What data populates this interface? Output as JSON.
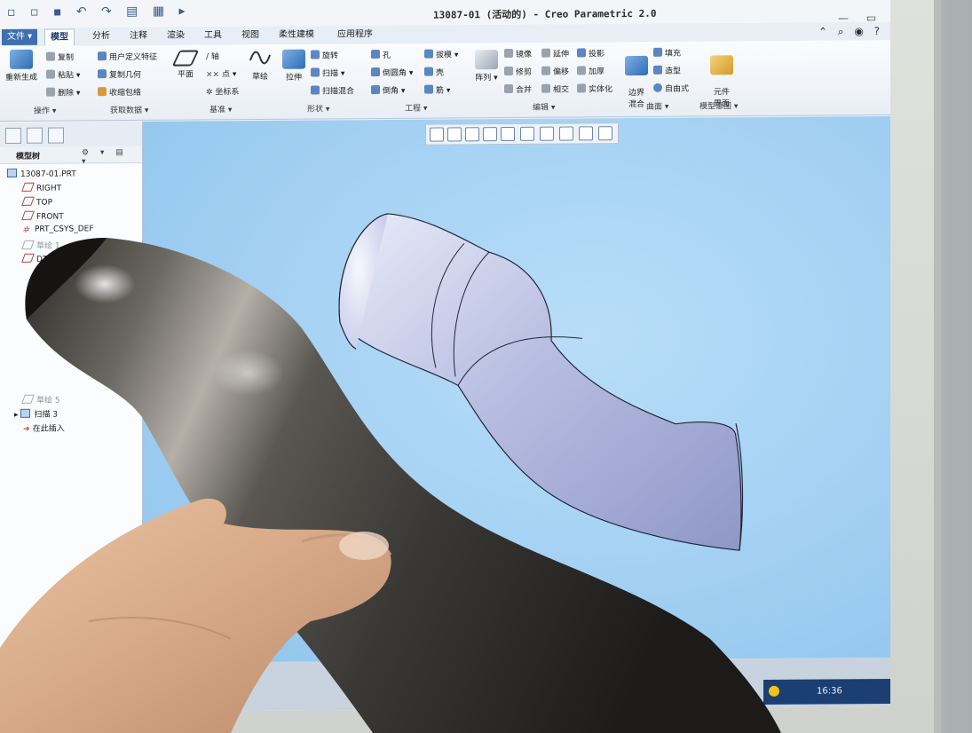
{
  "window": {
    "title": "13087-01 (活动的) - Creo Parametric 2.0"
  },
  "ribbon_tabs": [
    "文件 ▾",
    "模型",
    "分析",
    "注释",
    "渲染",
    "工具",
    "视图",
    "柔性建模",
    "应用程序"
  ],
  "ribbon": {
    "operations": {
      "regenerate": "重新生成",
      "copy": "复制",
      "paste": "粘贴",
      "delete": "删除"
    },
    "get_data": {
      "user_defined_feature": "用户定义特征",
      "copy_geometry": "复制几何",
      "shrinkwrap": "收缩包络"
    },
    "datum": {
      "plane": "平面",
      "axis": "轴",
      "point": "点",
      "csys": "坐标系",
      "sketch": "草绘"
    },
    "shapes": {
      "extrude": "拉伸",
      "revolve": "旋转",
      "sweep": "扫描",
      "swept_blend": "扫描混合"
    },
    "engineering": {
      "hole": "孔",
      "round": "倒圆角",
      "chamfer": "倒角",
      "draft": "拔模",
      "shell": "壳",
      "rib": "筋"
    },
    "editing": {
      "pattern": "阵列",
      "mirror": "镜像",
      "trim": "修剪",
      "merge": "合并",
      "extend": "延伸",
      "offset": "偏移",
      "intersect": "相交",
      "project": "投影",
      "thicken": "加厚",
      "solidify": "实体化"
    },
    "surfaces": {
      "boundary_blend": "边界\n混合",
      "fill": "填充",
      "style": "造型",
      "freestyle": "自由式"
    },
    "model_intent": {
      "component_interface": "元件\n界面"
    },
    "groups": [
      "操作",
      "获取数据",
      "基准",
      "形状",
      "工程",
      "编辑",
      "曲面",
      "模型意图"
    ]
  },
  "model_tree": {
    "header": "模型树",
    "items": [
      {
        "label": "13087-01.PRT",
        "icon": "part-icon",
        "faded": false
      },
      {
        "label": "RIGHT",
        "icon": "datum-plane-icon",
        "faded": false
      },
      {
        "label": "TOP",
        "icon": "datum-plane-icon",
        "faded": false
      },
      {
        "label": "FRONT",
        "icon": "datum-plane-icon",
        "faded": false
      },
      {
        "label": "PRT_CSYS_DEF",
        "icon": "csys-icon",
        "faded": false
      },
      {
        "label": "草绘 1",
        "icon": "sketch-icon",
        "faded": true
      },
      {
        "label": "DTM",
        "icon": "datum-plane-icon",
        "faded": false
      },
      {
        "label": "扫描 3",
        "icon": "sweep-icon",
        "faded": false
      },
      {
        "label": "在此插入",
        "icon": "insert-here-icon",
        "faded": false
      }
    ],
    "faded_item_label": "草绘 5"
  },
  "taskbar": {
    "clock": "16:36"
  }
}
